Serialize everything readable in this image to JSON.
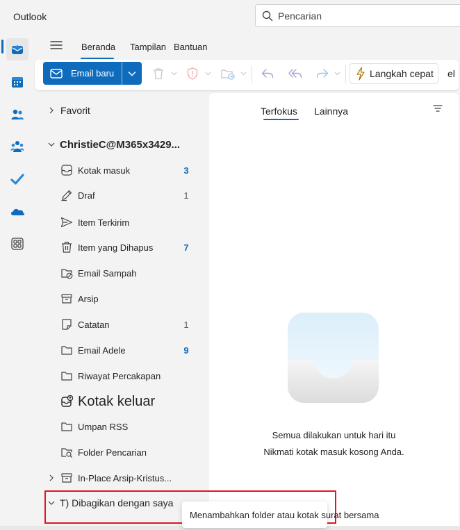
{
  "app": {
    "title": "Outlook"
  },
  "search": {
    "placeholder": "Pencarian"
  },
  "ribbon": {
    "tabs": [
      "Beranda",
      "Tampilan",
      "Bantuan"
    ]
  },
  "toolbar": {
    "new_mail_label": "Email baru",
    "quick_steps_label": "Langkah cepat",
    "overflow_label": "el"
  },
  "folders": {
    "favorites_label": "Favorit",
    "account_label": "ChristieC@M365x3429...",
    "items": [
      {
        "label": "Kotak masuk",
        "icon": "inbox-icon",
        "count": "3",
        "count_style": "unread"
      },
      {
        "label": "Draf",
        "icon": "drafts-icon",
        "count": "1",
        "count_style": "muted"
      },
      {
        "label": "Item Terkirim",
        "icon": "sent-icon",
        "count": "",
        "count_style": ""
      },
      {
        "label": "Item yang Dihapus",
        "icon": "trash-icon",
        "count": "7",
        "count_style": "unread"
      },
      {
        "label": "Email Sampah",
        "icon": "junk-folder-icon",
        "count": "",
        "count_style": ""
      },
      {
        "label": "Arsip",
        "icon": "archive-icon",
        "count": "",
        "count_style": ""
      },
      {
        "label": "Catatan",
        "icon": "note-icon",
        "count": "1",
        "count_style": "muted"
      },
      {
        "label": "Email Adele",
        "icon": "folder-icon",
        "count": "9",
        "count_style": "unread"
      },
      {
        "label": "Riwayat Percakapan",
        "icon": "folder-icon",
        "count": "",
        "count_style": ""
      },
      {
        "label": "Kotak keluar",
        "icon": "outbox-icon",
        "count": "",
        "count_style": ""
      },
      {
        "label": "Umpan RSS",
        "icon": "folder-icon",
        "count": "",
        "count_style": ""
      },
      {
        "label": "Folder Pencarian",
        "icon": "search-folder-icon",
        "count": "",
        "count_style": ""
      }
    ],
    "inplace_archive_label": "In-Place Arsip-Kristus...",
    "shared_label": "T) Dibagikan dengan saya"
  },
  "tooltip": {
    "text": "Menambahkan folder atau kotak surat bersama"
  },
  "mail_list": {
    "tabs": [
      "Terfokus",
      "Lainnya"
    ],
    "empty_title": "Semua dilakukan untuk hari itu",
    "empty_subtitle": "Nikmati kotak masuk kosong Anda."
  },
  "colors": {
    "accent": "#0f6cbd",
    "highlight": "#e81123"
  }
}
